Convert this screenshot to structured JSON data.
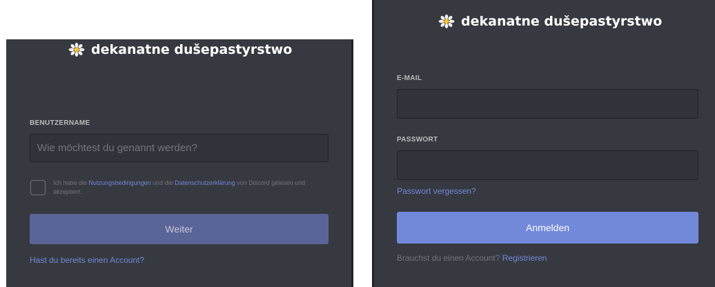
{
  "register": {
    "brand": "dekanatne dušepastyrstwo",
    "username_label": "BENUTZERNAME",
    "username_placeholder": "Wie möchtest du genannt werden?",
    "terms_prefix": "Ich habe die ",
    "terms_link": "Nutzungsbedingungen",
    "terms_middle": " und die ",
    "privacy_link": "Datenschutzerklärung",
    "terms_suffix": " von Discord gelesen und akzeptiert.",
    "continue_button": "Weiter",
    "login_link": "Hast du bereits einen Account?"
  },
  "login": {
    "brand": "dekanatne dušepastyrstwo",
    "email_label": "E-MAIL",
    "email_value": "",
    "password_label": "PASSWORT",
    "password_value": "",
    "forgot_link": "Passwort vergessen?",
    "login_button": "Anmelden",
    "need_account_text": "Brauchst du einen Account?",
    "register_link": "Registrieren"
  },
  "colors": {
    "background": "#36393f",
    "input": "#303339",
    "accent": "#7289da",
    "accent_disabled": "#5b6496",
    "muted": "#72767d"
  },
  "icons": {
    "logo": "daisy-flower-icon"
  }
}
